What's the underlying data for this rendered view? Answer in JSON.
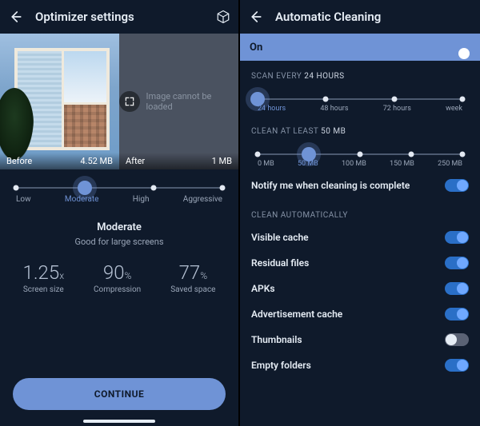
{
  "left": {
    "title": "Optimizer settings",
    "compare": {
      "before_label": "Before",
      "before_size": "4.52 MB",
      "after_label": "After",
      "after_size": "1 MB",
      "after_error": "Image cannot be loaded"
    },
    "quality_slider": {
      "options": [
        "Low",
        "Moderate",
        "High",
        "Aggressive"
      ],
      "selected_index": 1
    },
    "quality_title": "Moderate",
    "quality_sub": "Good for large screens",
    "stats": {
      "screen_size": {
        "value": "1.25",
        "unit": "x",
        "label": "Screen size"
      },
      "compression": {
        "value": "90",
        "unit": "%",
        "label": "Compression"
      },
      "saved": {
        "value": "77",
        "unit": "%",
        "label": "Saved space"
      }
    },
    "continue": "CONTINUE"
  },
  "right": {
    "title": "Automatic Cleaning",
    "on_label": "On",
    "scan": {
      "head_prefix": "SCAN EVERY",
      "head_value": "24 HOURS",
      "options": [
        "24 hours",
        "48 hours",
        "72 hours",
        "week"
      ],
      "selected_index": 0
    },
    "clean_at_least": {
      "head_prefix": "CLEAN AT LEAST",
      "head_value": "50 MB",
      "options": [
        "0 MB",
        "50 MB",
        "100 MB",
        "150 MB",
        "250 MB"
      ],
      "selected_index": 1
    },
    "notify_label": "Notify me when cleaning is complete",
    "auto_head": "CLEAN AUTOMATICALLY",
    "auto_items": [
      {
        "label": "Visible cache",
        "on": true
      },
      {
        "label": "Residual files",
        "on": true
      },
      {
        "label": "APKs",
        "on": true
      },
      {
        "label": "Advertisement cache",
        "on": true
      },
      {
        "label": "Thumbnails",
        "on": false
      },
      {
        "label": "Empty folders",
        "on": true
      }
    ]
  }
}
